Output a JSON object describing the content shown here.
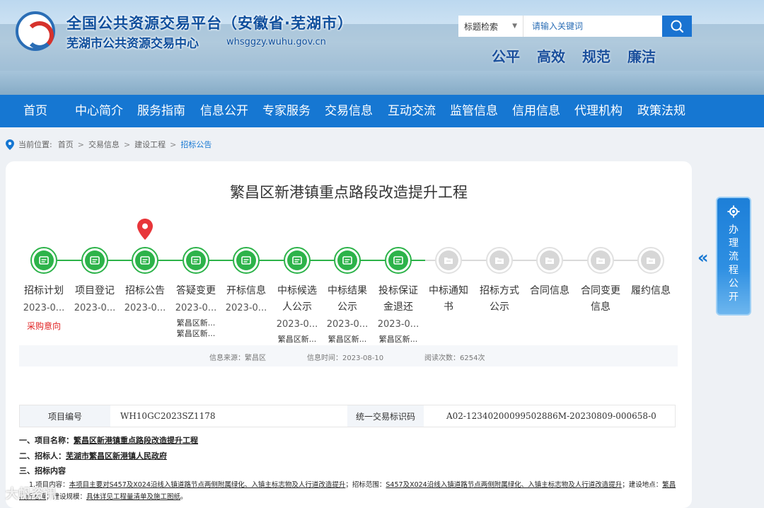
{
  "header": {
    "site_title": "全国公共资源交易平台（安徽省·芜湖市）",
    "site_subtitle": "芜湖市公共资源交易中心",
    "domain": "whsggzy.wuhu.gov.cn",
    "search_type": "标题检索",
    "search_placeholder": "请输入关键词",
    "slogans": [
      "公平",
      "高效",
      "规范",
      "廉洁"
    ]
  },
  "nav": {
    "items": [
      "首页",
      "中心简介",
      "服务指南",
      "信息公开",
      "专家服务",
      "交易信息",
      "互动交流",
      "监管信息",
      "信用信息",
      "代理机构",
      "政策法规"
    ]
  },
  "breadcrumb": {
    "label": "当前位置:",
    "items": [
      "首页",
      "交易信息",
      "建设工程",
      "招标公告"
    ]
  },
  "page": {
    "title": "繁昌区新港镇重点路段改造提升工程"
  },
  "steps": [
    {
      "label": "招标计划",
      "date": "2023-0...",
      "note": "采购意向",
      "active": true,
      "sub": []
    },
    {
      "label": "项目登记",
      "date": "2023-0...",
      "active": true,
      "sub": []
    },
    {
      "label": "招标公告",
      "date": "2023-0...",
      "active": true,
      "current": true,
      "sub": []
    },
    {
      "label": "答疑变更",
      "date": "2023-0...",
      "active": true,
      "sub": [
        "繁昌区新...",
        "繁昌区新..."
      ]
    },
    {
      "label": "开标信息",
      "date": "2023-0...",
      "active": true,
      "sub": []
    },
    {
      "label": "中标候选人公示",
      "date": "2023-0...",
      "active": true,
      "sub": [
        "繁昌区新..."
      ]
    },
    {
      "label": "中标结果公示",
      "date": "2023-0...",
      "active": true,
      "sub": [
        "繁昌区新..."
      ]
    },
    {
      "label": "投标保证金退还",
      "date": "2023-0...",
      "active": true,
      "sub": [
        "繁昌区新..."
      ]
    },
    {
      "label": "中标通知书",
      "active": false,
      "sub": []
    },
    {
      "label": "招标方式公示",
      "active": false,
      "sub": []
    },
    {
      "label": "合同信息",
      "active": false,
      "sub": []
    },
    {
      "label": "合同变更信息",
      "active": false,
      "sub": []
    },
    {
      "label": "履约信息",
      "active": false,
      "sub": []
    }
  ],
  "meta": {
    "source": "信息来源：繁昌区",
    "time": "信息时间：2023-08-10",
    "views": "阅读次数：6254次"
  },
  "info": {
    "project_no_label": "项目编号",
    "project_no": "WH10GC2023SZ1178",
    "unified_id_label": "统一交易标识码",
    "unified_id": "A02-12340200099502886M-20230809-000658-0"
  },
  "content": {
    "s1_label": "一、项目名称：",
    "s1_value": "繁昌区新港镇重点路段改造提升工程",
    "s2_label": "二、招标人：",
    "s2_value": "芜湖市繁昌区新港镇人民政府",
    "s3_label": "三、招标内容",
    "p1_a": "1.项目内容：",
    "p1_b": "本项目主要对S457及X024沿线入镇道路节点两侧附属绿化、入镇主标志物及人行道改造提升",
    "p1_c": "；招标范围：",
    "p1_d": "S457及X024沿线入镇道路节点两侧附属绿化、入镇主标志物及人行道改造提升",
    "p1_e": "；建设地点：",
    "p1_f": "繁昌区新港镇",
    "p1_g": "；建设规模：",
    "p1_h": "具体详见工程量清单及施工图纸",
    "p1_i": "。"
  },
  "side": {
    "panel_text": "办理流程公开"
  },
  "watermark": "大帆资讯"
}
